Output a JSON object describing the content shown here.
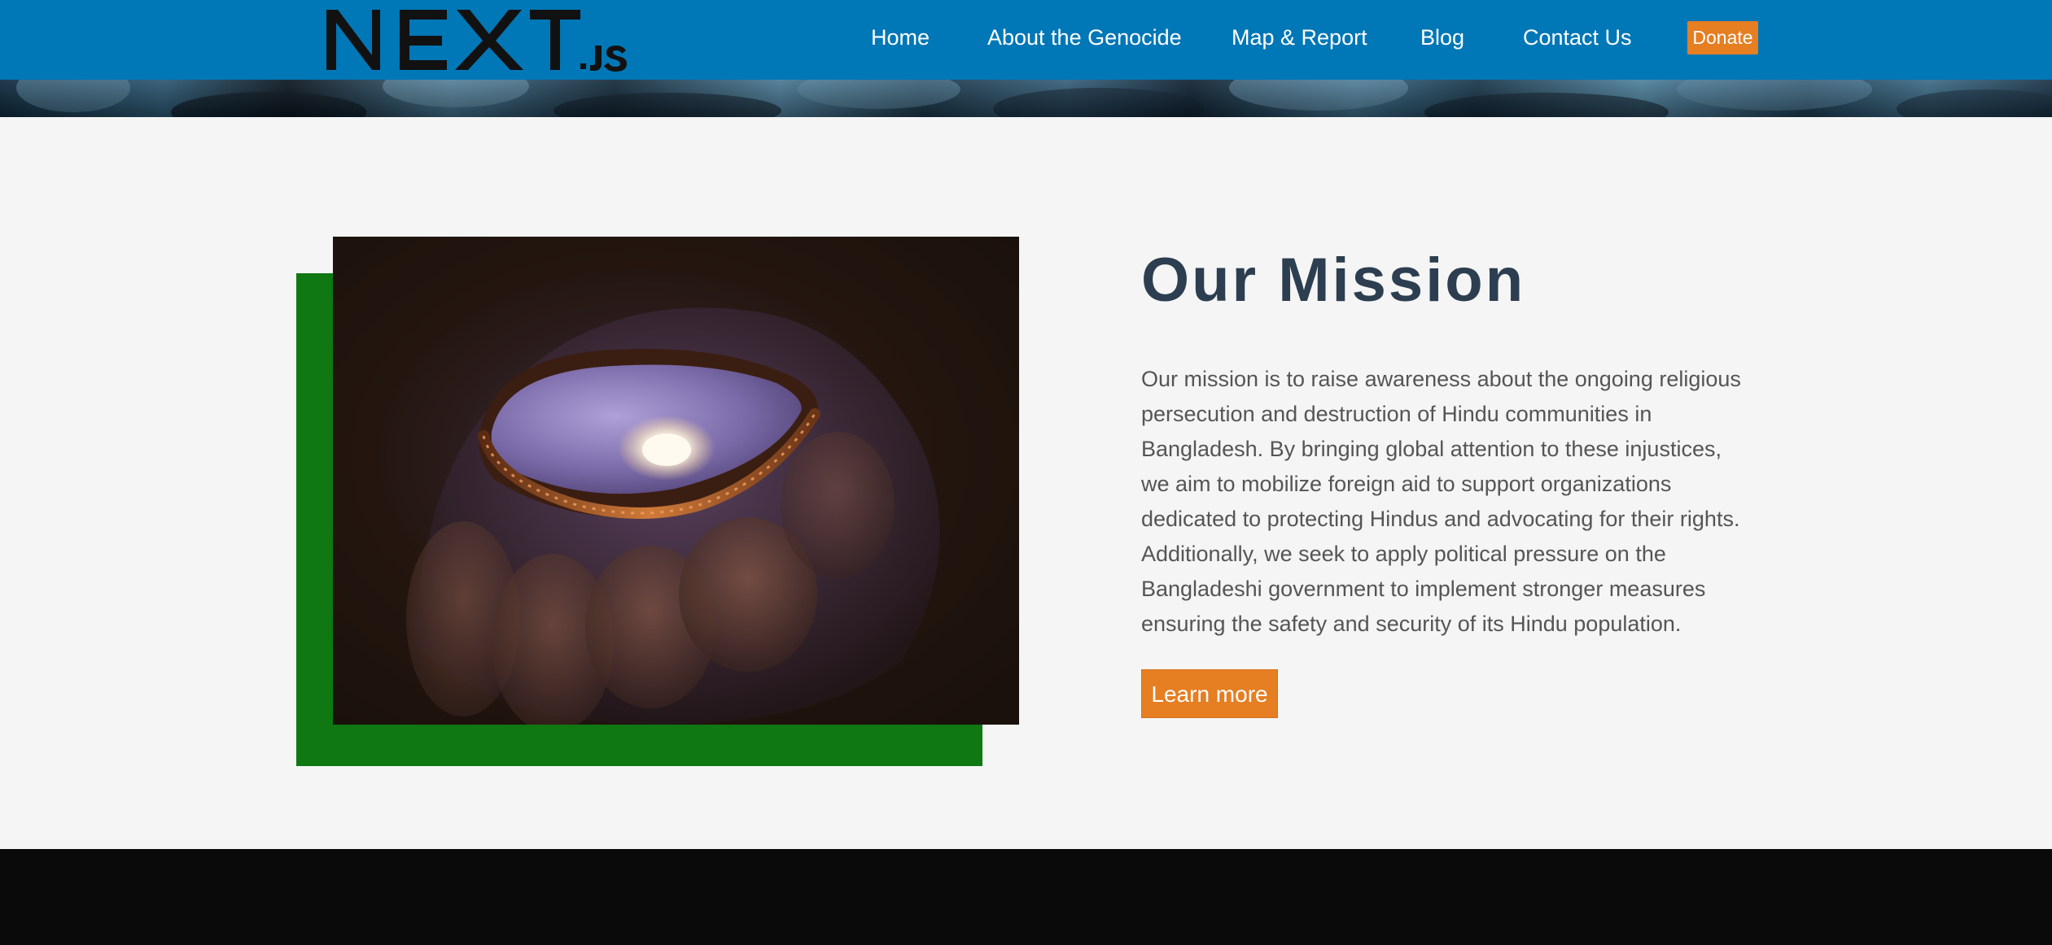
{
  "header": {
    "logo_text": "NEXT.JS",
    "nav": [
      {
        "label": "Home"
      },
      {
        "label": "About the Genocide"
      },
      {
        "label": "Map & Report"
      },
      {
        "label": "Blog"
      },
      {
        "label": "Contact Us"
      }
    ],
    "donate_label": "Donate"
  },
  "mission": {
    "title": "Our Mission",
    "body": "Our mission is to raise awareness about the ongoing religious persecution and destruction of Hindu communities in Bangladesh. By bringing global attention to these injustices, we aim to mobilize foreign aid to support organizations dedicated to protecting Hindus and advocating for their rights. Additionally, we seek to apply political pressure on the Bangladeshi government to implement stronger measures ensuring the safety and security of its Hindu population.",
    "button_label": "Learn more",
    "image_icon": "diya-lamp-in-hand-photo"
  },
  "colors": {
    "header_bg": "#0077b6",
    "accent_orange": "#e67e22",
    "green_block": "#0f7812",
    "title_color": "#2c3e50",
    "footer_bg": "#0a0a0a"
  }
}
